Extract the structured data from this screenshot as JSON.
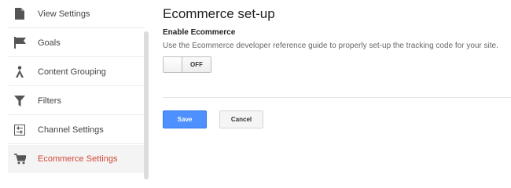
{
  "sidebar": {
    "items": [
      {
        "label": "View Settings",
        "icon": "document-icon"
      },
      {
        "label": "Goals",
        "icon": "flag-icon"
      },
      {
        "label": "Content Grouping",
        "icon": "person-walking-icon"
      },
      {
        "label": "Filters",
        "icon": "funnel-icon"
      },
      {
        "label": "Channel Settings",
        "icon": "sliders-icon"
      },
      {
        "label": "Ecommerce Settings",
        "icon": "shopping-cart-icon",
        "active": true
      }
    ]
  },
  "main": {
    "title": "Ecommerce set-up",
    "enable_label": "Enable Ecommerce",
    "description": "Use the Ecommerce developer reference guide to properly set-up the tracking code for your site.",
    "toggle_state": "OFF",
    "save_label": "Save",
    "cancel_label": "Cancel"
  },
  "colors": {
    "active_text": "#d14836",
    "primary_button": "#4d90fe"
  }
}
